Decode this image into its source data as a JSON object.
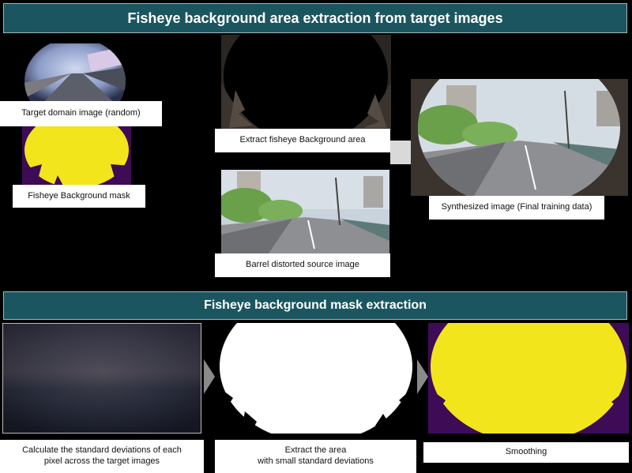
{
  "top_banner": {
    "title": "Fisheye background area extraction from target images"
  },
  "bottom_banner": {
    "title": "Fisheye background mask extraction"
  },
  "labels": {
    "target_domain": "Target domain image (random)",
    "fisheye_mask": "Fisheye Background mask",
    "extract_area": "Extract fisheye Background area",
    "barrel_source": "Barrel distorted source image",
    "synthesized": "Synthesized image (Final training data)",
    "std_dev": "Calculate the standard deviations of each\npixel across the target images",
    "extract_small": "Extract the area\nwith small standard deviations",
    "smoothing": "Smoothing"
  },
  "colors": {
    "banner_bg": "#1b5660",
    "mask_yellow": "#f2e51c",
    "mask_purple": "#3e0b56",
    "arrow_gray": "#8a8a8a"
  }
}
